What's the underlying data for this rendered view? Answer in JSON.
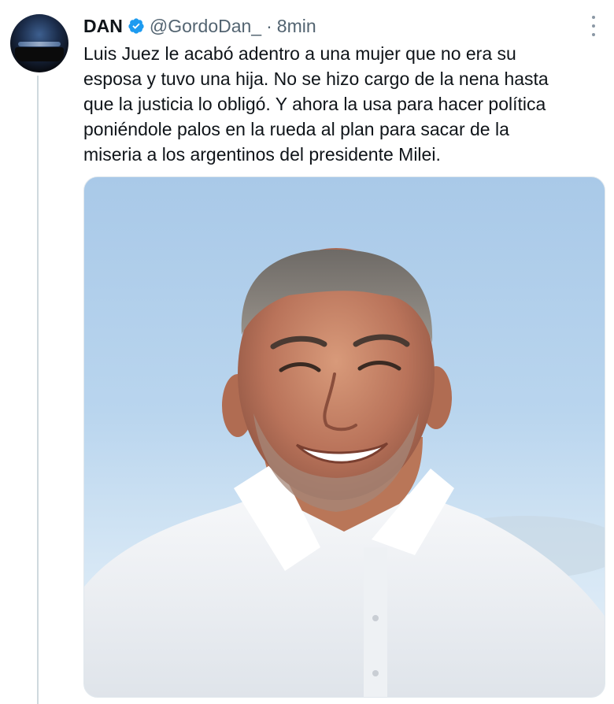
{
  "tweet": {
    "display_name": "DAN",
    "handle": "@GordoDan_",
    "separator": "·",
    "time": "8min",
    "text": "Luis Juez le acabó adentro a una mujer que no era su\nesposa y tuvo una hija. No se hizo cargo de la nena hasta\nque la justicia lo obligó. Y ahora la usa para hacer política\nponiéndole palos en la rueda al plan para sacar de la\nmiseria a los argentinos del presidente Milei.",
    "verified_icon": "verified-badge-icon",
    "more_icon": "more-options-icon",
    "media": {
      "description_icon": "photo",
      "sky_color": "#b9d5ee",
      "shirt_color": "#f2f4f6"
    }
  },
  "colors": {
    "verified": "#1d9bf0",
    "secondary_text": "#536471",
    "thread_line": "#cfd9de"
  }
}
